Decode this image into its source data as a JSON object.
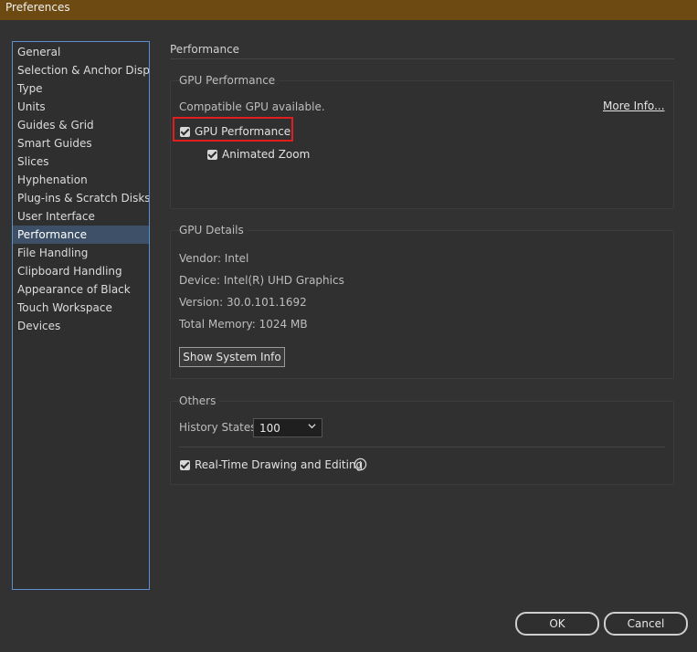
{
  "window": {
    "title": "Preferences"
  },
  "sidebar": {
    "items": [
      {
        "label": "General"
      },
      {
        "label": "Selection & Anchor Display"
      },
      {
        "label": "Type"
      },
      {
        "label": "Units"
      },
      {
        "label": "Guides & Grid"
      },
      {
        "label": "Smart Guides"
      },
      {
        "label": "Slices"
      },
      {
        "label": "Hyphenation"
      },
      {
        "label": "Plug-ins & Scratch Disks"
      },
      {
        "label": "User Interface"
      },
      {
        "label": "Performance"
      },
      {
        "label": "File Handling"
      },
      {
        "label": "Clipboard Handling"
      },
      {
        "label": "Appearance of Black"
      },
      {
        "label": "Touch Workspace"
      },
      {
        "label": "Devices"
      }
    ],
    "selected": "Performance"
  },
  "main": {
    "title": "Performance",
    "gpu_performance": {
      "heading": "GPU Performance",
      "status_text": "Compatible GPU available.",
      "more_info_link": "More Info...",
      "gpu_checkbox_label": "GPU Performance",
      "gpu_checked": true,
      "animated_zoom_label": "Animated Zoom",
      "animated_zoom_checked": true
    },
    "gpu_details": {
      "heading": "GPU Details",
      "vendor": "Vendor: Intel",
      "device": "Device: Intel(R) UHD Graphics",
      "version": "Version: 30.0.101.1692",
      "memory": "Total Memory: 1024 MB",
      "show_info_button": "Show System Info"
    },
    "others": {
      "heading": "Others",
      "history_label": "History States:",
      "history_value": "100",
      "realtime_label": "Real-Time Drawing and Editing",
      "realtime_checked": true
    }
  },
  "footer": {
    "ok_label": "OK",
    "cancel_label": "Cancel"
  },
  "colors": {
    "highlight": "#e01e1e",
    "selection": "#3d5068",
    "titlebar": "#6d4a12"
  },
  "icons": [
    "checkbox-checked",
    "chevron-down-icon",
    "info-icon"
  ]
}
